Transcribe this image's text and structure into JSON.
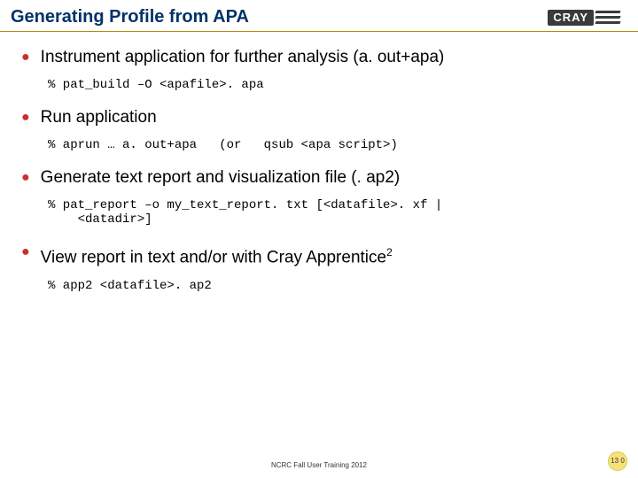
{
  "header": {
    "title": "Generating Profile from APA",
    "logo_text": "CRAY"
  },
  "items": [
    {
      "title": "Instrument application for further analysis (a. out+apa)",
      "code": "% pat_build –O <apafile>. apa"
    },
    {
      "title": "Run application",
      "code": "% aprun … a. out+apa   (or   qsub <apa script>)"
    },
    {
      "title": "Generate text report and visualization file (. ap2)",
      "code": "% pat_report –o my_text_report. txt [<datafile>. xf |\n    <datadir>]"
    },
    {
      "title_html": "View report in text and/or with Cray Apprentice<sup>2</sup>",
      "title": "View report in text and/or with Cray Apprentice2",
      "code": "% app2 <datafile>. ap2"
    }
  ],
  "footer": "NCRC Fall User Training 2012",
  "page_number": "13\n0"
}
